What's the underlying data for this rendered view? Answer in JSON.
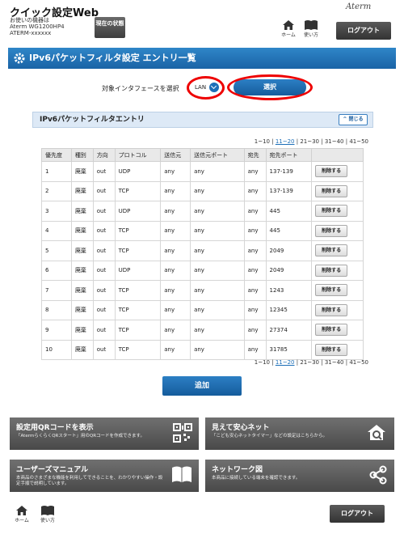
{
  "header": {
    "app_title": "クイック設定Web",
    "device_line1": "お使いの機器は",
    "device_line2": "Aterm WG1200HP4",
    "device_line3": "ATERM-xxxxxx",
    "status_button": "現在の状態",
    "brand": "Aterm",
    "home_label": "ホーム",
    "help_label": "使い方",
    "logout_label": "ログアウト"
  },
  "page": {
    "title": "IPv6パケットフィルタ設定 エントリ一覧",
    "interface_label": "対象インタフェースを選択",
    "interface_value": "LAN",
    "select_button": "選択",
    "section_title": "IPv6パケットフィルタエントリ",
    "close_button": "閉じる",
    "pager": [
      "1~10",
      "11~20",
      "21~30",
      "31~40",
      "41~50"
    ],
    "pager_current_index": 1,
    "add_button": "追加"
  },
  "table": {
    "headers": [
      "優先度",
      "種別",
      "方向",
      "プロトコル",
      "送信元",
      "送信元ポート",
      "宛先",
      "宛先ポート",
      ""
    ],
    "delete_label": "削除する",
    "rows": [
      [
        "1",
        "廃棄",
        "out",
        "UDP",
        "any",
        "any",
        "any",
        "137-139"
      ],
      [
        "2",
        "廃棄",
        "out",
        "TCP",
        "any",
        "any",
        "any",
        "137-139"
      ],
      [
        "3",
        "廃棄",
        "out",
        "UDP",
        "any",
        "any",
        "any",
        "445"
      ],
      [
        "4",
        "廃棄",
        "out",
        "TCP",
        "any",
        "any",
        "any",
        "445"
      ],
      [
        "5",
        "廃棄",
        "out",
        "TCP",
        "any",
        "any",
        "any",
        "2049"
      ],
      [
        "6",
        "廃棄",
        "out",
        "UDP",
        "any",
        "any",
        "any",
        "2049"
      ],
      [
        "7",
        "廃棄",
        "out",
        "TCP",
        "any",
        "any",
        "any",
        "1243"
      ],
      [
        "8",
        "廃棄",
        "out",
        "TCP",
        "any",
        "any",
        "any",
        "12345"
      ],
      [
        "9",
        "廃棄",
        "out",
        "TCP",
        "any",
        "any",
        "any",
        "27374"
      ],
      [
        "10",
        "廃棄",
        "out",
        "TCP",
        "any",
        "any",
        "any",
        "31785"
      ]
    ]
  },
  "tiles": [
    {
      "title": "設定用QRコードを表示",
      "desc": "「AtermらくらくQRスタート」用のQRコードを作成できます。",
      "icon": "qr-code-icon"
    },
    {
      "title": "見えて安心ネット",
      "desc": "「こども安心ネットタイマー」などの設定はこちらから。",
      "icon": "house-search-icon"
    },
    {
      "title": "ユーザーズマニュアル",
      "desc": "本商品のさまざまな機能を利用してできることを、わかりやすい操作・設定手順で説明しています。",
      "icon": "book-icon"
    },
    {
      "title": "ネットワーク図",
      "desc": "本商品に接続している端末を確認できます。",
      "icon": "network-icon"
    }
  ],
  "footer": {
    "home_label": "ホーム",
    "help_label": "使い方",
    "logout_label": "ログアウト"
  },
  "colors": {
    "accent_blue": "#1a63a6",
    "highlight_red": "#e00000",
    "tile_gray": "#5a5a5a"
  }
}
